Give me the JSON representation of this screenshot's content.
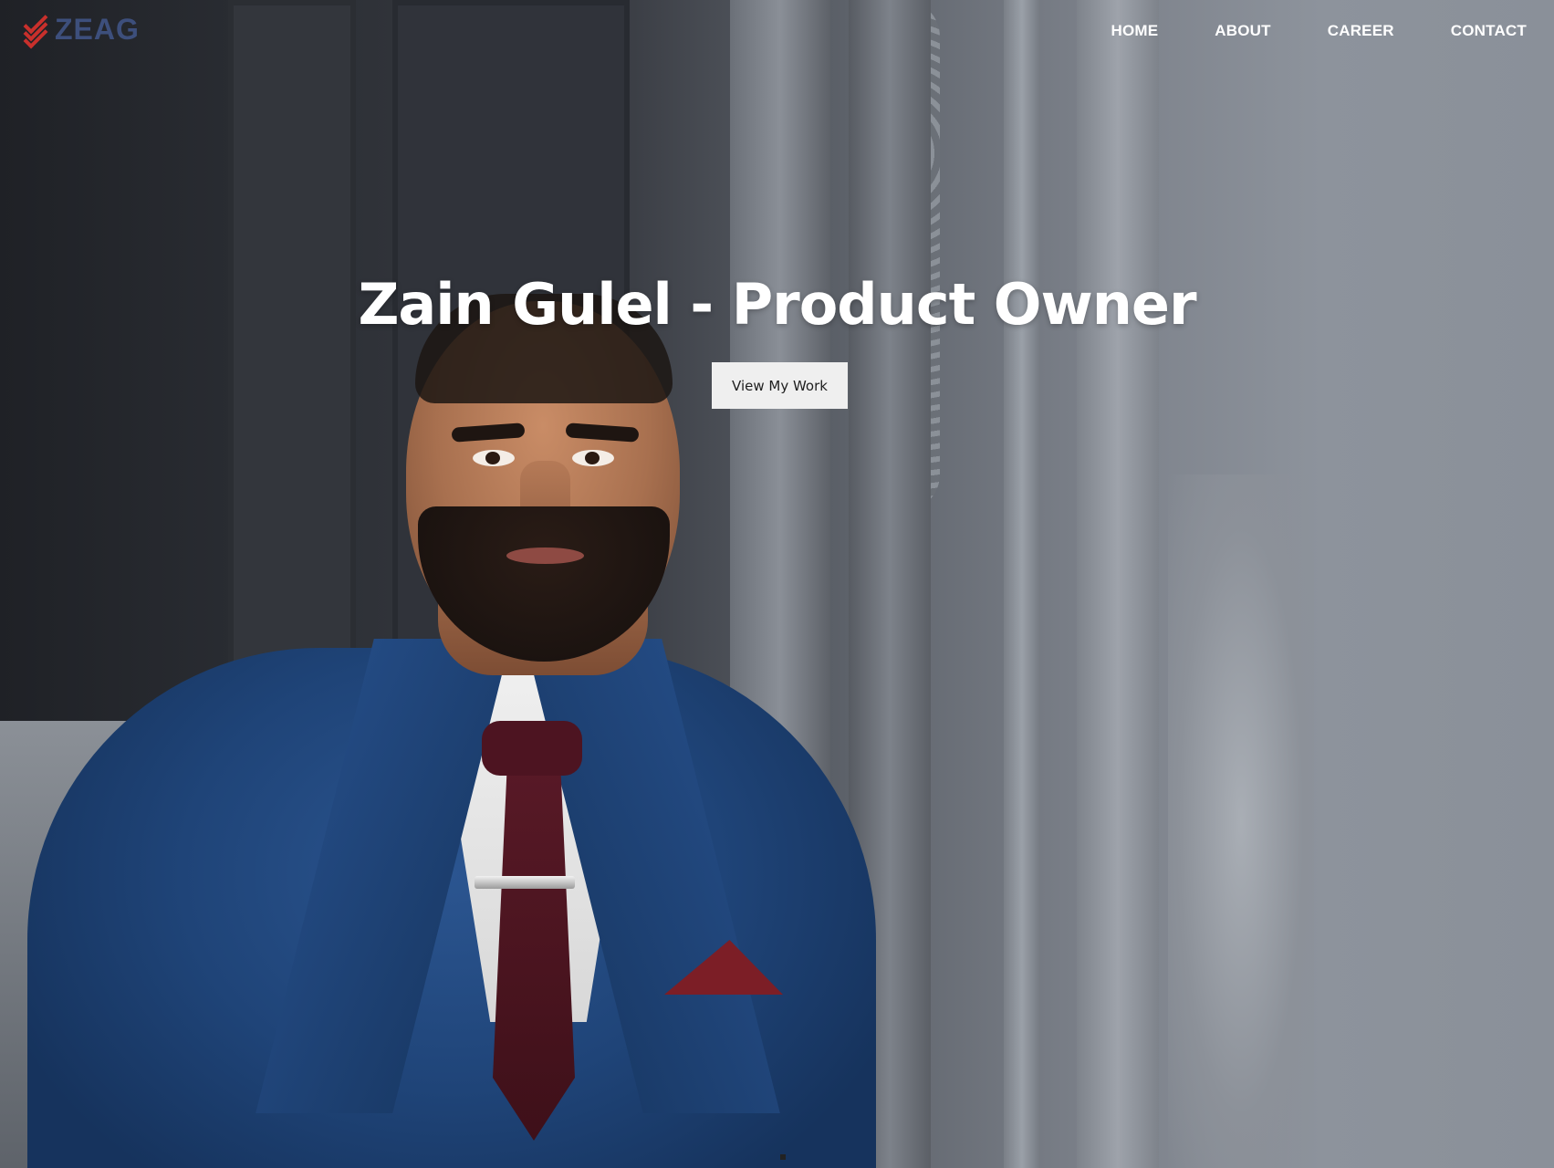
{
  "brand": {
    "name": "ZEAG",
    "icon": "triple-chevron-down-icon",
    "icon_color": "#c9302c",
    "text_color": "#3d4f7c"
  },
  "nav": {
    "items": [
      {
        "label": "HOME"
      },
      {
        "label": "ABOUT"
      },
      {
        "label": "CAREER"
      },
      {
        "label": "CONTACT"
      }
    ]
  },
  "hero": {
    "headline": "Zain Gulel - Product Owner",
    "cta_label": "View My Work",
    "background_image": "portrait-man-blue-suit-ornate-wall"
  }
}
